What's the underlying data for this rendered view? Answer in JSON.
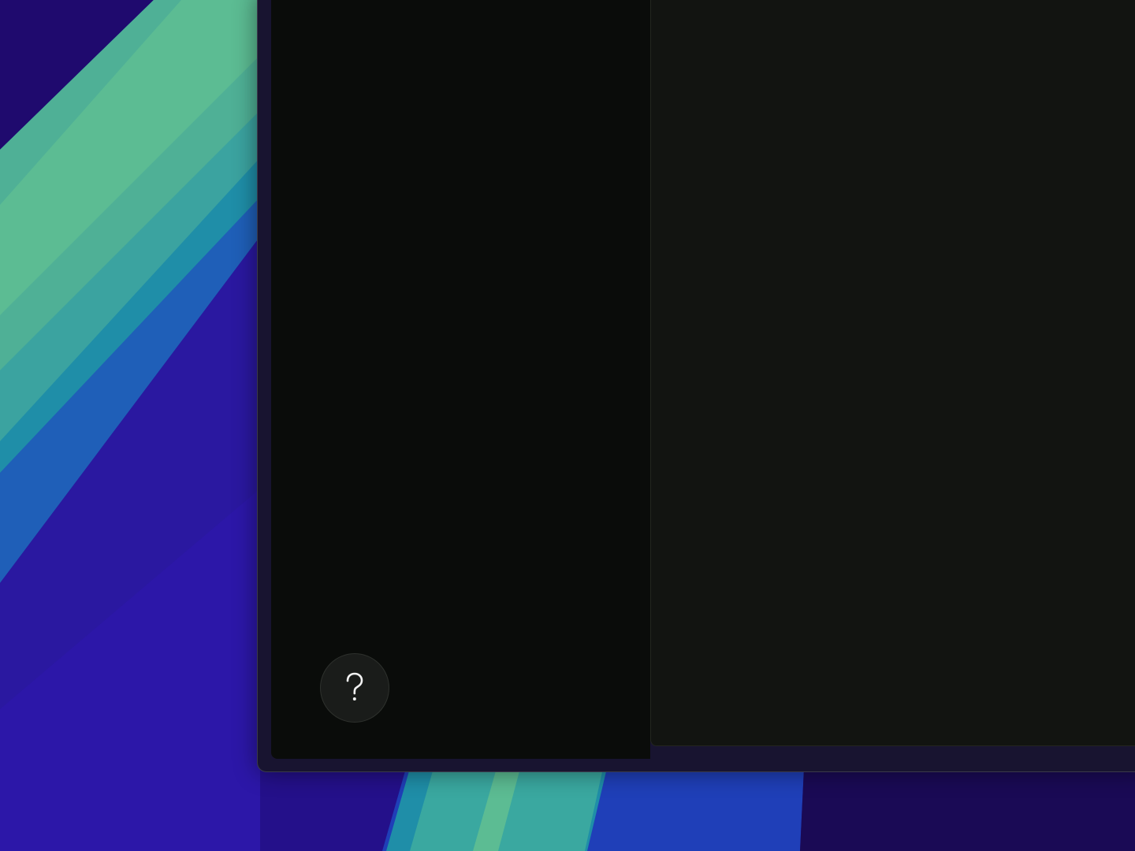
{
  "desktop": {
    "colors": {
      "deep_indigo": "#24108a",
      "violet": "#2a1aa6",
      "royal_blue": "#1f3fb8",
      "teal": "#1f8ea8",
      "mint": "#56b894",
      "dark_purple": "#1a0a55"
    }
  },
  "window": {
    "left_pane": {
      "help_button": {
        "icon": "question-mark-icon",
        "glyph": "?"
      }
    },
    "right_pane": {},
    "colors": {
      "left_pane_bg": "#0a0c0a",
      "right_pane_bg": "#121411",
      "help_button_bg": "#1a1c1a",
      "icon_color": "#f2f2f2"
    }
  }
}
